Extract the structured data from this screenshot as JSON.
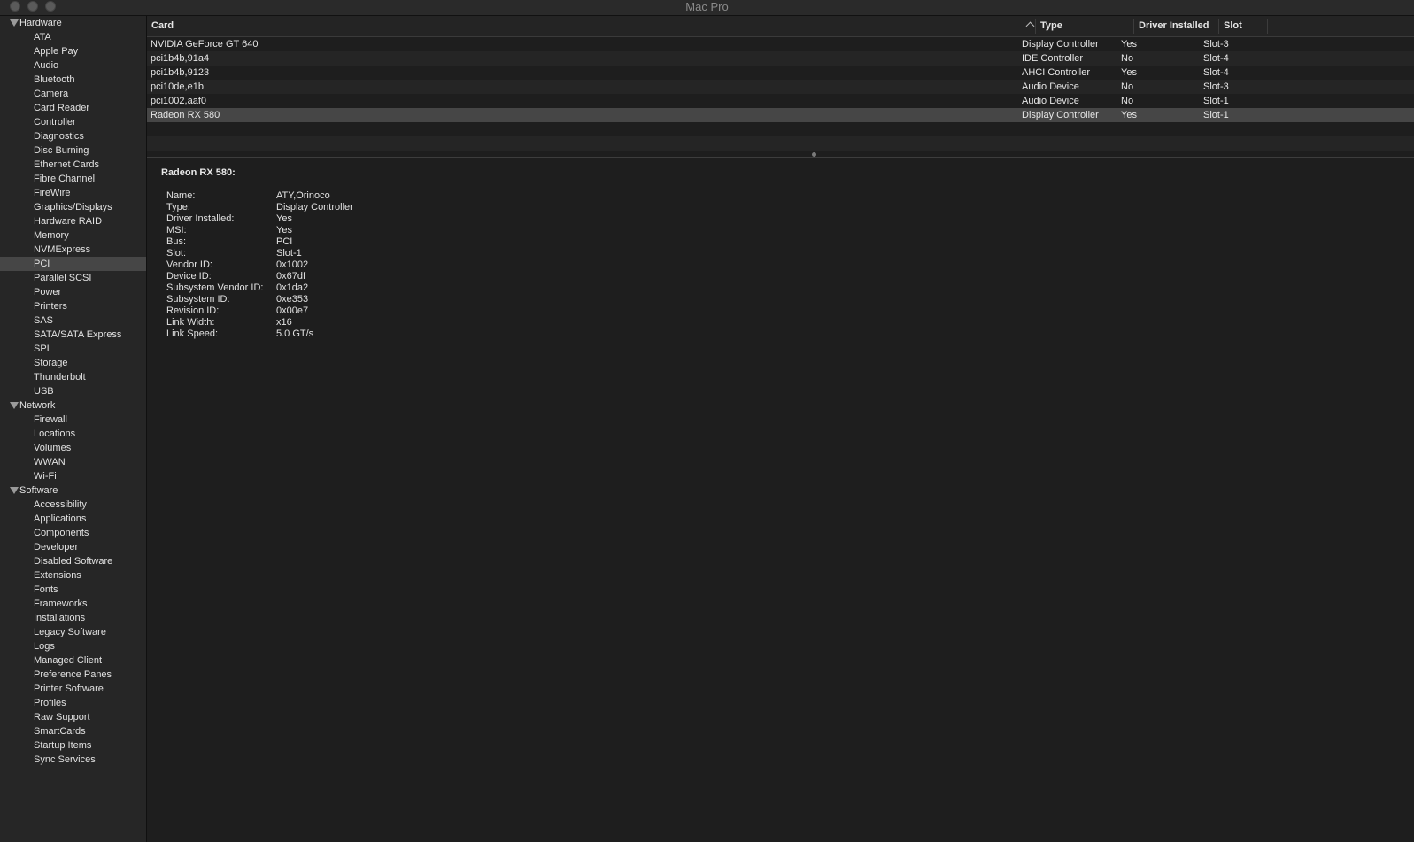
{
  "window": {
    "title": "Mac Pro"
  },
  "sidebar": {
    "groups": [
      {
        "label": "Hardware",
        "items": [
          "ATA",
          "Apple Pay",
          "Audio",
          "Bluetooth",
          "Camera",
          "Card Reader",
          "Controller",
          "Diagnostics",
          "Disc Burning",
          "Ethernet Cards",
          "Fibre Channel",
          "FireWire",
          "Graphics/Displays",
          "Hardware RAID",
          "Memory",
          "NVMExpress",
          "PCI",
          "Parallel SCSI",
          "Power",
          "Printers",
          "SAS",
          "SATA/SATA Express",
          "SPI",
          "Storage",
          "Thunderbolt",
          "USB"
        ]
      },
      {
        "label": "Network",
        "items": [
          "Firewall",
          "Locations",
          "Volumes",
          "WWAN",
          "Wi-Fi"
        ]
      },
      {
        "label": "Software",
        "items": [
          "Accessibility",
          "Applications",
          "Components",
          "Developer",
          "Disabled Software",
          "Extensions",
          "Fonts",
          "Frameworks",
          "Installations",
          "Legacy Software",
          "Logs",
          "Managed Client",
          "Preference Panes",
          "Printer Software",
          "Profiles",
          "Raw Support",
          "SmartCards",
          "Startup Items",
          "Sync Services"
        ]
      }
    ],
    "selected": "PCI"
  },
  "table": {
    "columns": [
      "Card",
      "Type",
      "Driver Installed",
      "Slot"
    ],
    "sort_icon": "chevron-up-icon",
    "rows": [
      [
        "NVIDIA GeForce GT 640",
        "Display Controller",
        "Yes",
        "Slot-3"
      ],
      [
        "pci1b4b,91a4",
        "IDE Controller",
        "No",
        "Slot-4"
      ],
      [
        "pci1b4b,9123",
        "AHCI Controller",
        "Yes",
        "Slot-4"
      ],
      [
        "pci10de,e1b",
        "Audio Device",
        "No",
        "Slot-3"
      ],
      [
        "pci1002,aaf0",
        "Audio Device",
        "No",
        "Slot-1"
      ],
      [
        "Radeon RX 580",
        "Display Controller",
        "Yes",
        "Slot-1"
      ]
    ],
    "selected_row": 5
  },
  "detail": {
    "title": "Radeon RX 580:",
    "fields": [
      [
        "Name:",
        "ATY,Orinoco"
      ],
      [
        "Type:",
        "Display Controller"
      ],
      [
        "Driver Installed:",
        "Yes"
      ],
      [
        "MSI:",
        "Yes"
      ],
      [
        "Bus:",
        "PCI"
      ],
      [
        "Slot:",
        "Slot-1"
      ],
      [
        "Vendor ID:",
        "0x1002"
      ],
      [
        "Device ID:",
        "0x67df"
      ],
      [
        "Subsystem Vendor ID:",
        "0x1da2"
      ],
      [
        "Subsystem ID:",
        "0xe353"
      ],
      [
        "Revision ID:",
        "0x00e7"
      ],
      [
        "Link Width:",
        "x16"
      ],
      [
        "Link Speed:",
        "5.0 GT/s"
      ]
    ]
  }
}
